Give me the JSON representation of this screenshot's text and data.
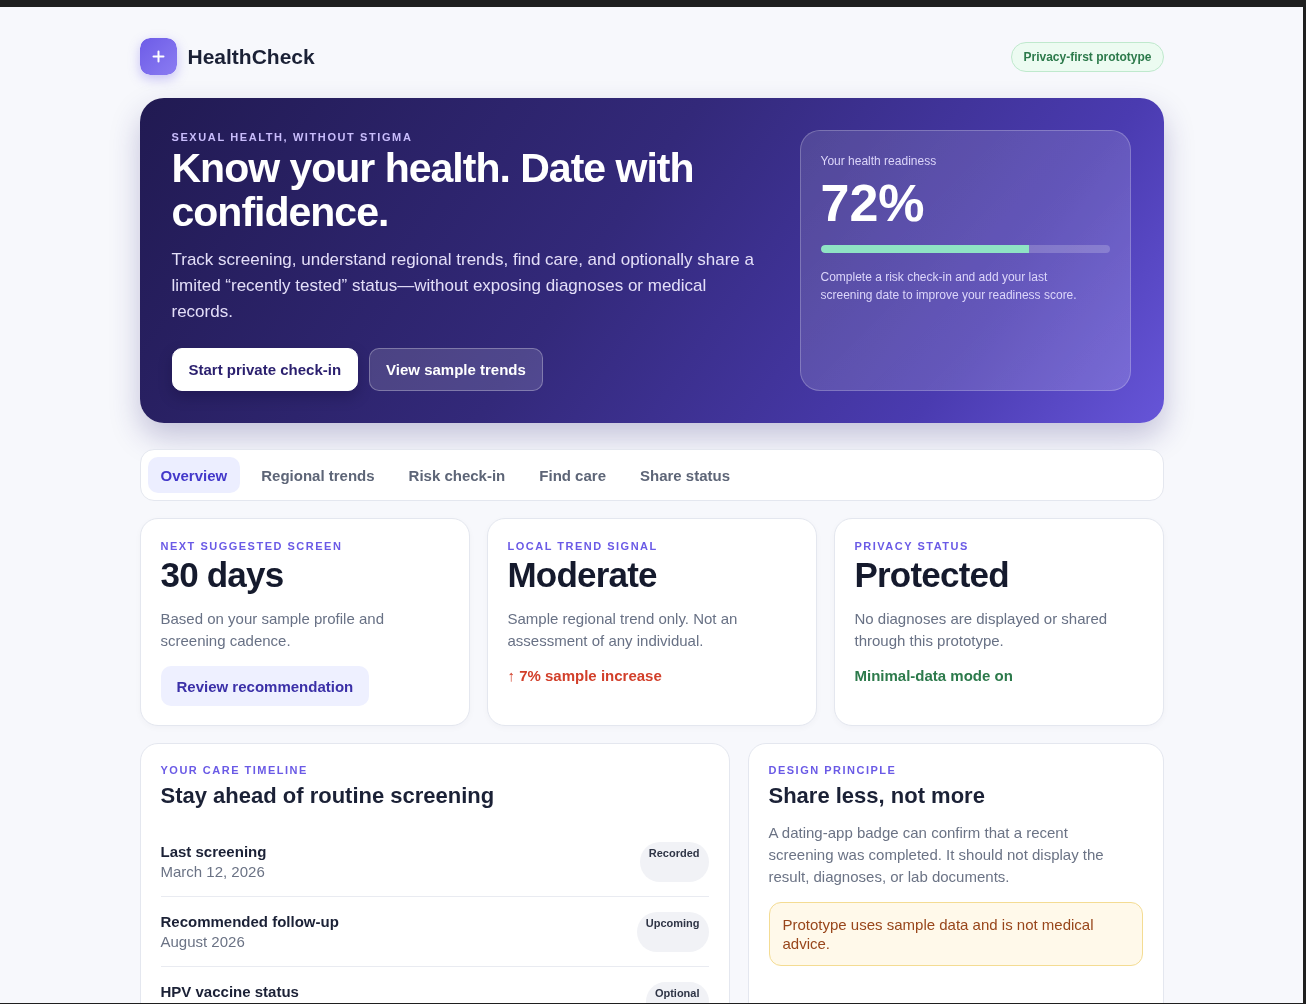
{
  "header": {
    "app_name": "HealthCheck",
    "badge": "Privacy-first prototype"
  },
  "hero": {
    "eyebrow": "SEXUAL HEALTH, WITHOUT STIGMA",
    "title": "Know your health. Date with confidence.",
    "description": "Track screening, understand regional trends, find care, and optionally share a limited “recently tested” status—without exposing diagnoses or medical records.",
    "buttons": [
      {
        "label": "Start private check-in",
        "kind": "primary"
      },
      {
        "label": "View sample trends",
        "kind": "secondary"
      }
    ],
    "readiness": {
      "label": "Your health readiness",
      "value": "72%",
      "level": 0.72,
      "hint": "Complete a risk check-in and add your last screening date to improve your readiness score."
    }
  },
  "tabs": [
    {
      "label": "Overview",
      "selected": true
    },
    {
      "label": "Regional trends",
      "selected": false
    },
    {
      "label": "Risk check-in",
      "selected": false
    },
    {
      "label": "Find care",
      "selected": false
    },
    {
      "label": "Share status",
      "selected": false
    }
  ],
  "cards": [
    {
      "eyebrow": "NEXT SUGGESTED SCREEN",
      "value": "30 days",
      "description": "Based on your sample profile and screening cadence.",
      "action": {
        "kind": "button",
        "label": "Review recommendation"
      }
    },
    {
      "eyebrow": "LOCAL TREND SIGNAL",
      "value": "Moderate",
      "description": "Sample regional trend only. Not an assessment of any individual.",
      "action": {
        "kind": "trend",
        "label": "↑ 7% sample increase"
      }
    },
    {
      "eyebrow": "PRIVACY STATUS",
      "value": "Protected",
      "description": "No diagnoses are displayed or shared through this prototype.",
      "action": {
        "kind": "status",
        "label": "Minimal-data mode on"
      }
    }
  ],
  "timeline": {
    "eyebrow": "YOUR CARE TIMELINE",
    "title": "Stay ahead of routine screening",
    "items": [
      {
        "title": "Last screening",
        "date": "March 12, 2026",
        "status": "Recorded"
      },
      {
        "title": "Recommended follow-up",
        "date": "August 2026",
        "status": "Upcoming"
      },
      {
        "title": "HPV vaccine status",
        "status": "Optional"
      }
    ]
  },
  "principle": {
    "eyebrow": "DESIGN PRINCIPLE",
    "title": "Share less, not more",
    "description": "A dating-app badge can confirm that a recent screening was completed. It should not display the result, diagnoses, or lab documents.",
    "notice": "Prototype uses sample data and is not medical advice."
  }
}
